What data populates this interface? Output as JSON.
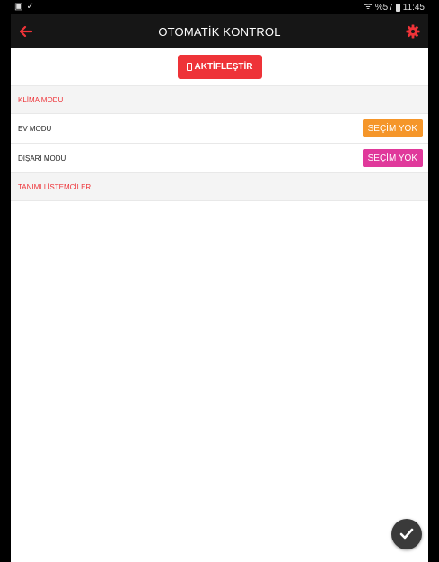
{
  "status_bar": {
    "left_icons": [
      "image-icon",
      "check-download-icon"
    ],
    "wifi_icon": "wifi-icon",
    "battery_percent": "%57",
    "time": "11:45"
  },
  "app_bar": {
    "title": "OTOMATİK KONTROL",
    "back_icon": "back-arrow-icon",
    "settings_icon": "gear-icon",
    "accent_color": "#ee3338"
  },
  "activate_button": {
    "label": "AKTİFLEŞTİR",
    "icon": "phone-icon",
    "color": "#ee3338"
  },
  "sections": [
    {
      "header": "KLİMA MODU"
    },
    {
      "header": "TANIMLI İSTEMCİLER"
    }
  ],
  "modes": [
    {
      "label": "EV MODU",
      "button_label": "SEÇİM YOK",
      "button_color": "#f5962a"
    },
    {
      "label": "DIŞARI MODU",
      "button_label": "SEÇİM YOK",
      "button_color": "#e0399b"
    }
  ],
  "fab": {
    "icon": "checkmark-icon"
  }
}
